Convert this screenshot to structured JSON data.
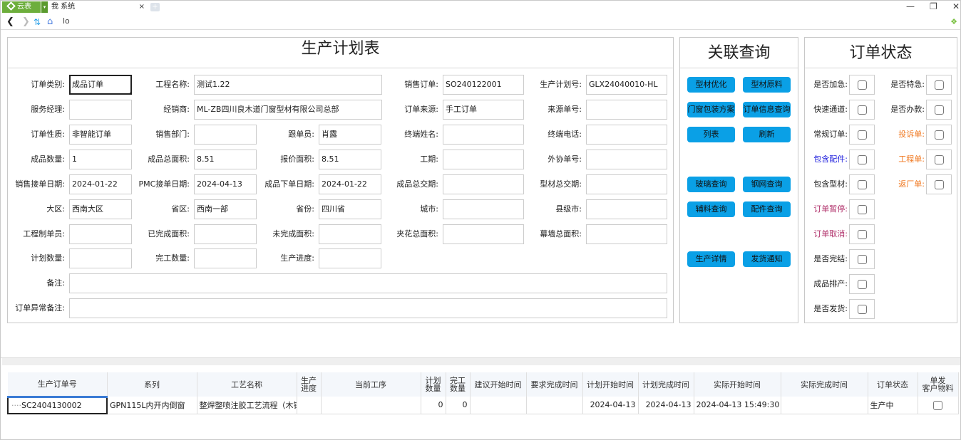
{
  "browser": {
    "app_tab_label": "云表",
    "doc_tab_label": "我  系统",
    "address": "lo",
    "close_icon": "×",
    "new_tab_icon": "+",
    "window_controls": {
      "minimize": "—",
      "restore": "❐",
      "close": "✕"
    }
  },
  "plan": {
    "title": "生产计划表",
    "fields": [
      {
        "label": "订单类别:",
        "value": "成品订单"
      },
      {
        "label": "工程名称:",
        "value": "测试1.22"
      },
      {
        "label": "销售订单:",
        "value": "SO240122001"
      },
      {
        "label": "生产计划号:",
        "value": "GLX24040010-HL"
      },
      {
        "label": "服务经理:",
        "value": ""
      },
      {
        "label": "经销商:",
        "value": "ML-ZB四川良木道门窗型材有限公司总部"
      },
      {
        "label": "订单来源:",
        "value": "手工订单"
      },
      {
        "label": "来源单号:",
        "value": ""
      },
      {
        "label": "订单性质:",
        "value": "非智能订单"
      },
      {
        "label": "销售部门:",
        "value": ""
      },
      {
        "label": "跟单员:",
        "value": "肖露"
      },
      {
        "label": "终端姓名:",
        "value": ""
      },
      {
        "label": "终端电话:",
        "value": ""
      },
      {
        "label": "成品数量:",
        "value": "1"
      },
      {
        "label": "成品总面积:",
        "value": "8.51"
      },
      {
        "label": "报价面积:",
        "value": "8.51"
      },
      {
        "label": "工期:",
        "value": ""
      },
      {
        "label": "外协单号:",
        "value": ""
      },
      {
        "label": "销售接单日期:",
        "value": "2024-01-22"
      },
      {
        "label": "PMC接单日期:",
        "value": "2024-04-13"
      },
      {
        "label": "成品下单日期:",
        "value": "2024-01-22"
      },
      {
        "label": "成品总交期:",
        "value": ""
      },
      {
        "label": "型材总交期:",
        "value": ""
      },
      {
        "label": "大区:",
        "value": "西南大区"
      },
      {
        "label": "省区:",
        "value": "西南一部"
      },
      {
        "label": "省份:",
        "value": "四川省"
      },
      {
        "label": "城市:",
        "value": ""
      },
      {
        "label": "县级市:",
        "value": ""
      },
      {
        "label": "工程制单员:",
        "value": ""
      },
      {
        "label": "已完成面积:",
        "value": ""
      },
      {
        "label": "未完成面积:",
        "value": ""
      },
      {
        "label": "夹花总面积:",
        "value": ""
      },
      {
        "label": "幕墙总面积:",
        "value": ""
      },
      {
        "label": "计划数量:",
        "value": ""
      },
      {
        "label": "完工数量:",
        "value": ""
      },
      {
        "label": "生产进度:",
        "value": ""
      },
      {
        "label": "备注:",
        "value": ""
      },
      {
        "label": "订单异常备注:",
        "value": ""
      }
    ]
  },
  "related": {
    "title": "关联查询",
    "buttons": [
      "型材优化",
      "型材原料",
      "门窗包装方案",
      "订单信息查询",
      "列表",
      "刷新",
      "玻璃查询",
      "钢网查询",
      "辅料查询",
      "配件查询",
      "生产详情",
      "发货通知"
    ],
    "button_color": "#0aa0e6"
  },
  "status": {
    "title": "订单状态",
    "items": [
      {
        "label": "是否加急:",
        "color": "#222222",
        "checked": false
      },
      {
        "label": "是否特急:",
        "color": "#222222",
        "checked": false
      },
      {
        "label": "快速通道:",
        "color": "#222222",
        "checked": false
      },
      {
        "label": "是否办款:",
        "color": "#222222",
        "checked": false
      },
      {
        "label": "常规订单:",
        "color": "#222222",
        "checked": false
      },
      {
        "label": "投诉单:",
        "color": "#f07820",
        "checked": false
      },
      {
        "label": "包含配件:",
        "color": "#1a1adc",
        "checked": false
      },
      {
        "label": "工程单:",
        "color": "#f07820",
        "checked": false
      },
      {
        "label": "包含型材:",
        "color": "#222222",
        "checked": false
      },
      {
        "label": "返厂单:",
        "color": "#f07820",
        "checked": false
      },
      {
        "label": "订单暂停:",
        "color": "#b0306a",
        "checked": false
      },
      {
        "label": "订单取消:",
        "color": "#b0306a",
        "checked": false
      },
      {
        "label": "是否完结:",
        "color": "#222222",
        "checked": false
      },
      {
        "label": "成品排产:",
        "color": "#222222",
        "checked": false
      },
      {
        "label": "是否发货:",
        "color": "#222222",
        "checked": false
      }
    ]
  },
  "table": {
    "columns": [
      "生产订单号",
      "系列",
      "工艺名称",
      "生产\n进度",
      "当前工序",
      "计划\n数量",
      "完工\n数量",
      "建议开始时间",
      "要求完成时间",
      "计划开始时间",
      "计划完成时间",
      "实际开始时间",
      "实际完成时间",
      "订单状态",
      "单发\n客户物料"
    ],
    "rows": [
      {
        "order_no": "SC2404130002",
        "series": "GPN115L内开内倒窗",
        "process_name": "整焊整喷注胶工艺流程（木铝",
        "progress": "",
        "current_step": "",
        "plan_qty": "0",
        "done_qty": "0",
        "suggest_start": "",
        "required_finish": "",
        "plan_start": "2024-04-13",
        "plan_finish": "2024-04-13",
        "actual_start": "2024-04-13 15:49:30",
        "actual_finish": "",
        "status": "生产中",
        "customer_material": false
      }
    ]
  }
}
